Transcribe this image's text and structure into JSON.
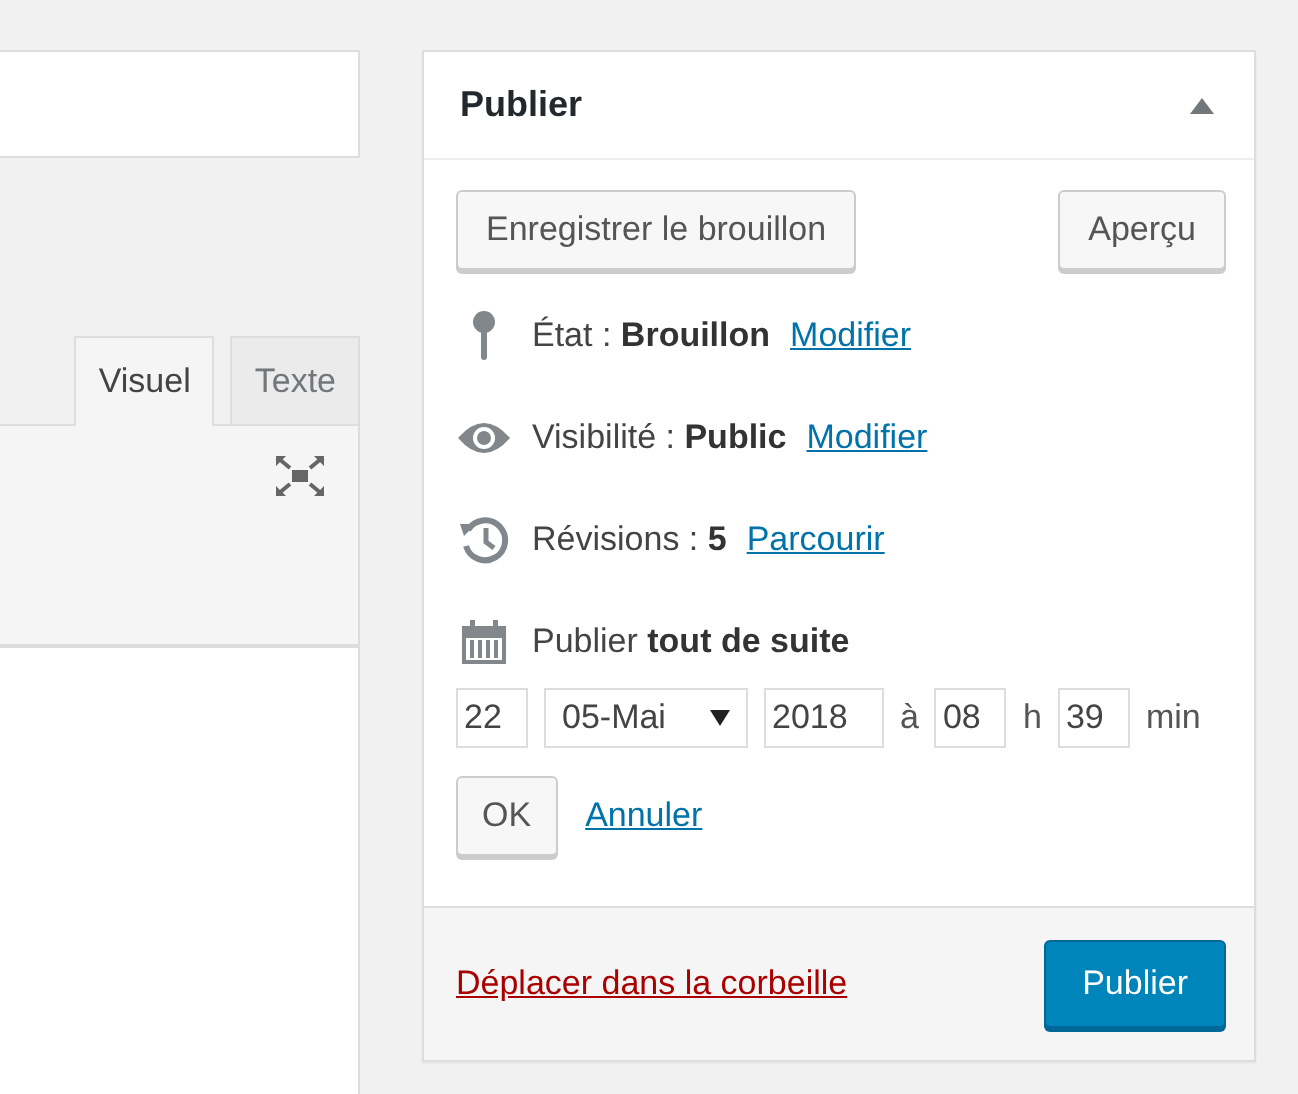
{
  "editor": {
    "tabs": [
      {
        "label": "Visuel",
        "selected": true
      },
      {
        "label": "Texte",
        "selected": false
      }
    ]
  },
  "publish_box": {
    "title": "Publier",
    "save_draft": "Enregistrer le brouillon",
    "preview": "Aperçu",
    "rows": [
      {
        "kind": "status",
        "label": "État :",
        "value": "Brouillon",
        "link": "Modifier"
      },
      {
        "kind": "visibility",
        "label": "Visibilité :",
        "value": "Public",
        "link": "Modifier"
      },
      {
        "kind": "revisions",
        "label": "Révisions :",
        "value": "5",
        "link": "Parcourir"
      },
      {
        "kind": "schedule",
        "label": "Publier",
        "value": "tout de suite"
      }
    ],
    "schedule": {
      "day": "22",
      "month": "05-Mai",
      "year": "2018",
      "at": "à",
      "hour": "08",
      "hour_unit": "h",
      "minute": "39",
      "minute_unit": "min"
    },
    "ok": "OK",
    "cancel": "Annuler",
    "trash": "Déplacer dans la corbeille",
    "publish": "Publier"
  }
}
